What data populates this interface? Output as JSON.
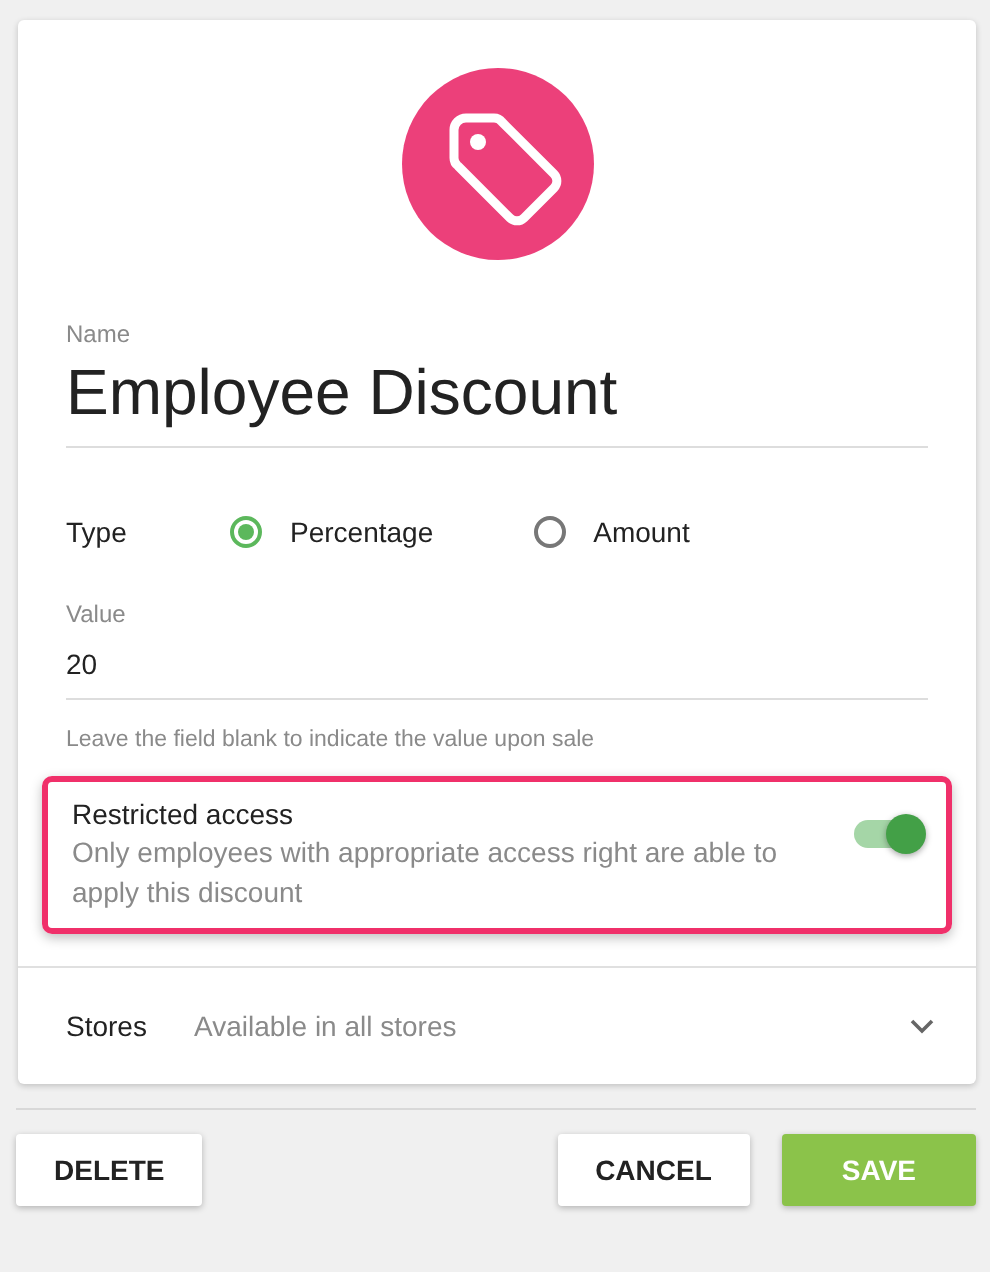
{
  "name_field": {
    "label": "Name",
    "value": "Employee Discount"
  },
  "type": {
    "label": "Type",
    "options": [
      {
        "label": "Percentage",
        "selected": true
      },
      {
        "label": "Amount",
        "selected": false
      }
    ]
  },
  "value_field": {
    "label": "Value",
    "value": "20",
    "hint": "Leave the field blank to indicate the value upon sale"
  },
  "restricted_access": {
    "title": "Restricted access",
    "description": "Only employees with appropriate access right are able to apply this discount",
    "on": true,
    "highlighted": true
  },
  "stores": {
    "label": "Stores",
    "value": "Available in all stores"
  },
  "buttons": [
    {
      "label": "DELETE",
      "kind": "plain"
    },
    {
      "label": "CANCEL",
      "kind": "plain"
    },
    {
      "label": "SAVE",
      "kind": "primary"
    }
  ]
}
